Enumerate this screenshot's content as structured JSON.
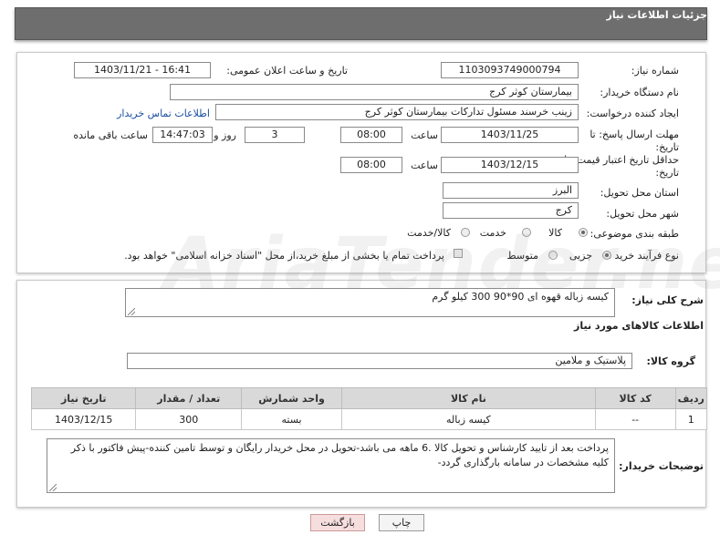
{
  "header": {
    "title": "جزئیات اطلاعات نیاز"
  },
  "form": {
    "need_number_label": "شماره نیاز:",
    "need_number": "1103093749000794",
    "announce_label": "تاریخ و ساعت اعلان عمومی:",
    "announce_value": "1403/11/21 - 16:41",
    "buyer_org_label": "نام دستگاه خریدار:",
    "buyer_org": "بیمارستان کوثر کرج",
    "creator_label": "ایجاد کننده درخواست:",
    "creator": "زینب خرسند مسئول تدارکات بیمارستان کوثر کرج",
    "contact_link": "اطلاعات تماس خریدار",
    "reply_deadline_label_1": "مهلت ارسال پاسخ: تا",
    "reply_deadline_label_2": "تاریخ:",
    "reply_date": "1403/11/25",
    "time_label": "ساعت",
    "reply_time": "08:00",
    "days_value": "3",
    "days_label": "روز و",
    "remaining_time": "14:47:03",
    "remaining_label": "ساعت باقی مانده",
    "validity_label_1": "حداقل تاریخ اعتبار قیمت: تا",
    "validity_label_2": "تاریخ:",
    "validity_date": "1403/12/15",
    "validity_time": "08:00",
    "province_label": "استان محل تحویل:",
    "province": "البرز",
    "city_label": "شهر محل تحویل:",
    "city": "کرج",
    "category_label": "طبقه بندی موضوعی:",
    "category_options": [
      "کالا",
      "خدمت",
      "کالا/خدمت"
    ],
    "process_label": "نوع فرآیند خرید :",
    "process_options": [
      "جزیی",
      "متوسط"
    ],
    "treasury_note": "پرداخت تمام یا بخشی از مبلغ خرید،از محل \"اسناد خزانه اسلامی\" خواهد بود."
  },
  "description": {
    "label": "شرح کلی نیاز:",
    "text": "کیسه زباله قهوه ای 90*90    300 کیلو گرم",
    "goods_info_title": "اطلاعات کالاهای مورد نیاز",
    "group_label": "گروه کالا:",
    "group_value": "پلاستیک و ملامین"
  },
  "table": {
    "headers": [
      "ردیف",
      "کد کالا",
      "نام کالا",
      "واحد شمارش",
      "تعداد / مقدار",
      "تاریخ نیاز"
    ],
    "rows": [
      [
        "1",
        "--",
        "کیسه زباله",
        "بسته",
        "300",
        "1403/12/15"
      ]
    ]
  },
  "buyer_notes": {
    "label": "توضیحات خریدار:",
    "text": "پرداخت بعد از تایید کارشناس و تحویل کالا .6 ماهه می باشد-تحویل در محل خریدار رایگان و توسط تامین کننده-پیش فاکتور با ذکر کلیه مشخصات در سامانه بارگذاری گردد-"
  },
  "buttons": {
    "print": "چاپ",
    "back": "بازگشت"
  },
  "watermark": "AriaTender.neT"
}
